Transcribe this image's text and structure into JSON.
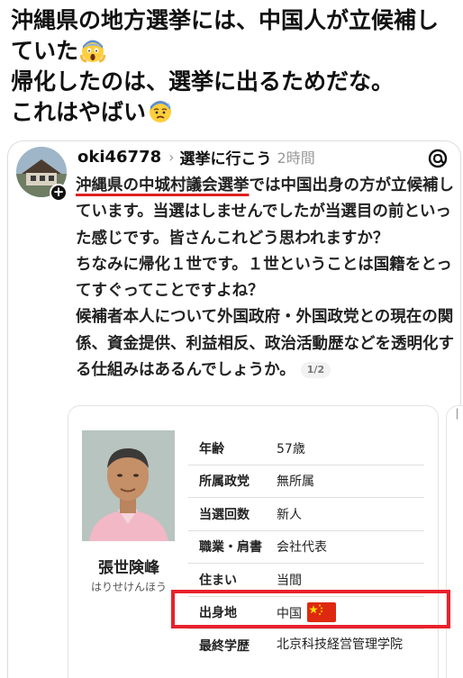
{
  "tweet": {
    "line1": "沖縄県の地方選挙には、中国人が立候補し",
    "line2": "ていた",
    "line3": "帰化したのは、選挙に出るためだな。",
    "line4": "これはやばい",
    "emoji_scream": "face-screaming-in-fear",
    "emoji_fearful": "anxious-face-with-sweat"
  },
  "post": {
    "username": "oki46778",
    "chevron": "›",
    "community": "選挙に行こう",
    "time": "2時間",
    "body_highlight": "沖縄県の中城村議会選挙",
    "body_p1_rest": "では中国出身の方が立候補しています。当選はしませんでしたが当選目の前といった感じです。皆さんこれどう思われますか？",
    "body_p2": "ちなみに帰化１世です。１世ということは国籍をとってすぐってことですよね？",
    "body_p3": "候補者本人について外国政府・外国政党との現在の関係、資金提供、利益相反、政治活動歴などを透明化する仕組みはあるんでしょうか。",
    "page_indicator": "1/2"
  },
  "candidate": {
    "name": "張世険峰",
    "kana": "はりせけんほう",
    "rows": [
      {
        "key": "年齢",
        "value": "57歳"
      },
      {
        "key": "所属政党",
        "value": "無所属"
      },
      {
        "key": "当選回数",
        "value": "新人"
      },
      {
        "key": "職業・肩書",
        "value": "会社代表"
      },
      {
        "key": "住まい",
        "value": "当間"
      },
      {
        "key": "出身地",
        "value": "中国"
      },
      {
        "key": "最終学歴",
        "value": "北京科技経営管理学院"
      }
    ]
  },
  "colors": {
    "highlight_underline": "#e02020",
    "annotation_box": "#e8212c",
    "flag_red": "#de2910",
    "flag_star": "#ffde00"
  }
}
